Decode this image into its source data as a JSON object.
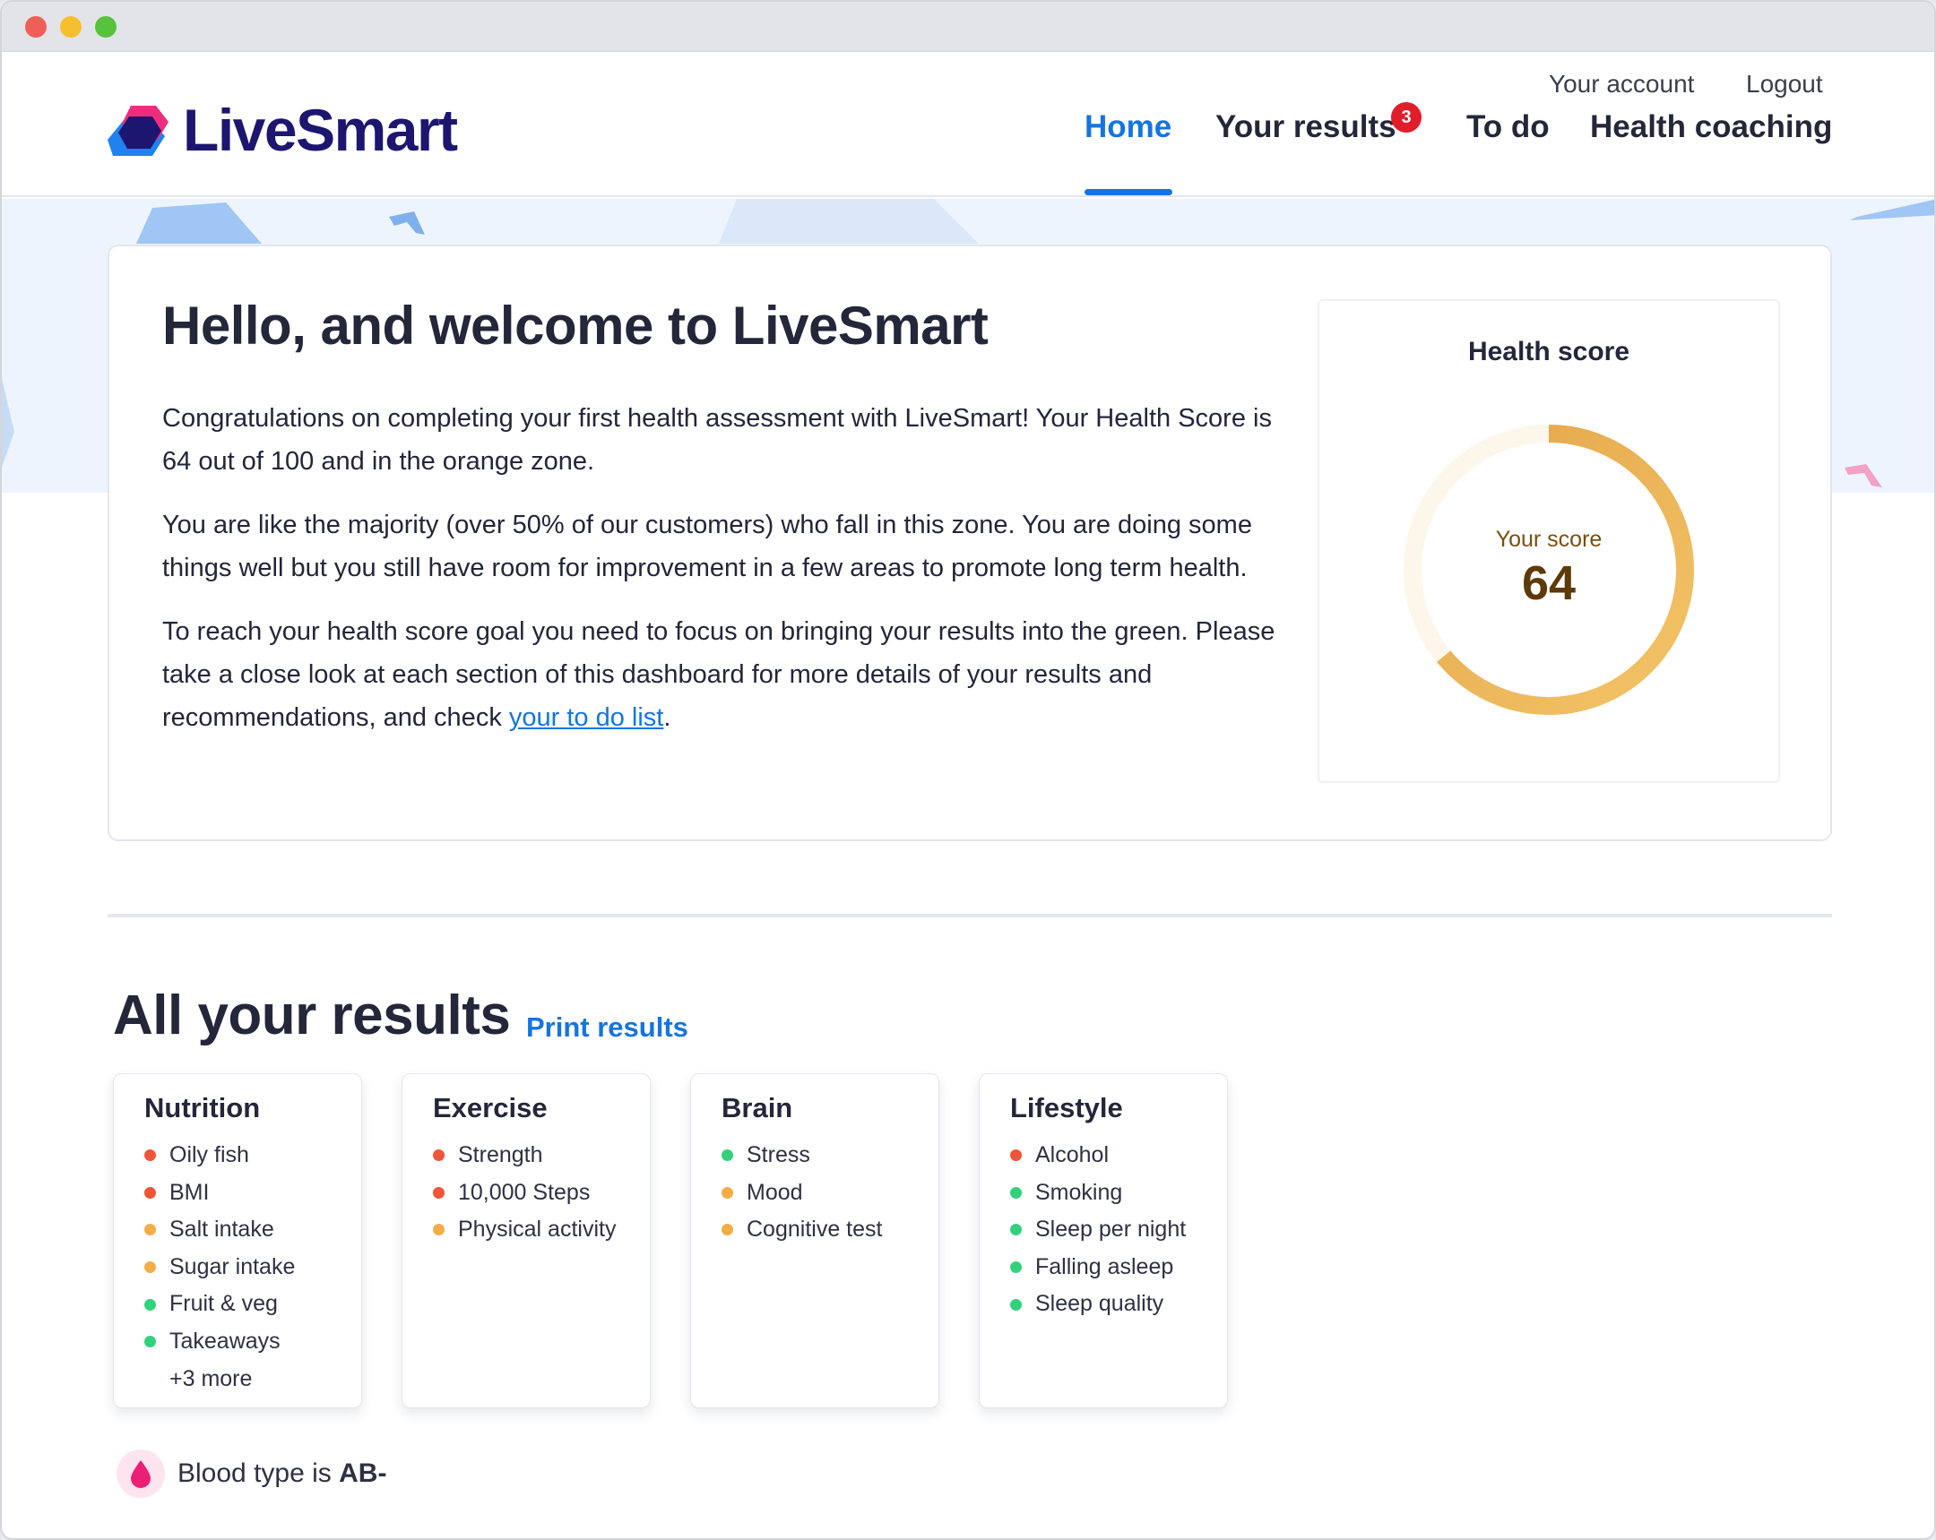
{
  "brand": {
    "name": "LiveSmart"
  },
  "header": {
    "utility": {
      "account": "Your account",
      "logout": "Logout"
    },
    "nav": {
      "home": "Home",
      "results": "Your results",
      "results_badge": "3",
      "todo": "To do",
      "coaching": "Health coaching"
    },
    "active": "Home"
  },
  "welcome": {
    "title": "Hello, and welcome to LiveSmart",
    "para1": "Congratulations on completing your first health assessment with LiveSmart! Your Health Score is 64 out of 100 and in the orange zone.",
    "para2": "You are like the majority (over 50% of our customers) who fall in this zone. You are doing some things well but you still have room for improvement in a few areas to promote long term health.",
    "para3_before": "To reach your health score goal you need to focus on bringing your results into the green. Please take a close look at each section of this dashboard for more details of your results and recommendations, and check ",
    "para3_link": "your to do list",
    "para3_after": "."
  },
  "health_score": {
    "title": "Health score",
    "label": "Your score",
    "value": "64",
    "max": 100,
    "colors": {
      "arc_start": "#f4c468",
      "arc_end": "#e3a448",
      "track": "#fdf6ea",
      "label": "#7a4f10",
      "value": "#5e3a08"
    }
  },
  "results": {
    "title": "All your results",
    "print_label": "Print results",
    "cards": [
      {
        "title": "Nutrition",
        "items": [
          {
            "label": "Oily fish",
            "status": "red"
          },
          {
            "label": "BMI",
            "status": "red"
          },
          {
            "label": "Salt intake",
            "status": "orange"
          },
          {
            "label": "Sugar intake",
            "status": "orange"
          },
          {
            "label": "Fruit & veg",
            "status": "green"
          },
          {
            "label": "Takeaways",
            "status": "green"
          }
        ],
        "more": "+3 more"
      },
      {
        "title": "Exercise",
        "items": [
          {
            "label": "Strength",
            "status": "red"
          },
          {
            "label": "10,000 Steps",
            "status": "red"
          },
          {
            "label": "Physical activity",
            "status": "orange"
          }
        ]
      },
      {
        "title": "Brain",
        "items": [
          {
            "label": "Stress",
            "status": "green"
          },
          {
            "label": "Mood",
            "status": "orange"
          },
          {
            "label": "Cognitive test",
            "status": "orange"
          }
        ]
      },
      {
        "title": "Lifestyle",
        "items": [
          {
            "label": "Alcohol",
            "status": "red"
          },
          {
            "label": "Smoking",
            "status": "green"
          },
          {
            "label": "Sleep per night",
            "status": "green"
          },
          {
            "label": "Falling asleep",
            "status": "green"
          },
          {
            "label": "Sleep quality",
            "status": "green"
          }
        ]
      }
    ]
  },
  "blood_type": {
    "prefix": "Blood type is ",
    "value": "AB-",
    "icon": "blood-drop-icon"
  },
  "status_colors": {
    "red": "#ef5537",
    "orange": "#f4ad46",
    "green": "#34d17c"
  },
  "accent": "#1575e0"
}
